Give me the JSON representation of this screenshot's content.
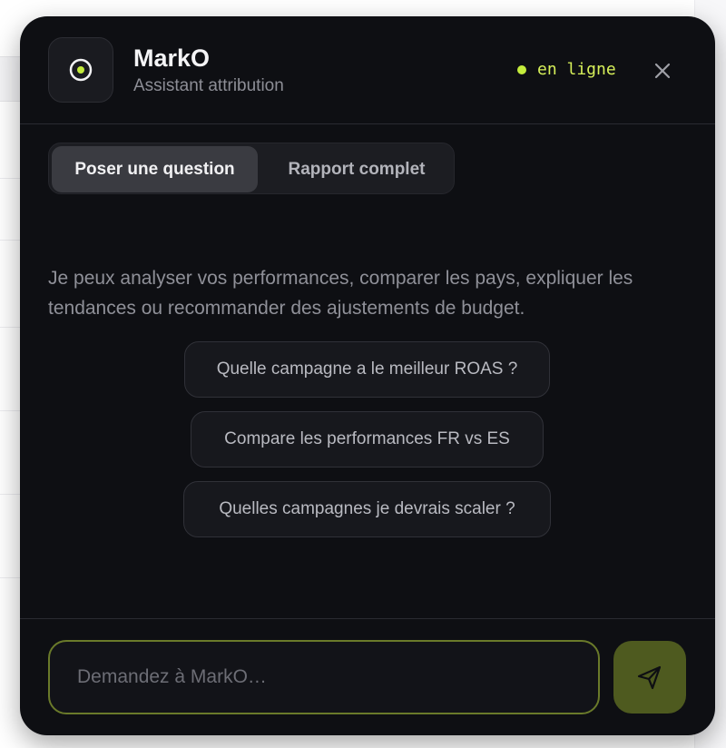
{
  "header": {
    "title": "MarkO",
    "subtitle": "Assistant attribution",
    "status_text": "en ligne",
    "avatar_icon": "target-icon",
    "close_icon": "close-icon"
  },
  "tabs": [
    {
      "label": "Poser une question",
      "active": true
    },
    {
      "label": "Rapport complet",
      "active": false
    }
  ],
  "intro_text": "Je peux analyser vos performances, comparer les pays, expliquer les tendances ou recommander des ajustements de budget.",
  "suggestions": [
    "Quelle campagne a le meilleur ROAS ?",
    "Compare les performances FR vs ES",
    "Quelles campagnes je devrais scaler ?"
  ],
  "input": {
    "placeholder": "Demandez à MarkO…",
    "value": ""
  },
  "send_icon": "send-icon",
  "colors": {
    "panel_bg": "#0e0f13",
    "accent": "#c4ec3c",
    "send_bg": "#4e5a1f"
  }
}
